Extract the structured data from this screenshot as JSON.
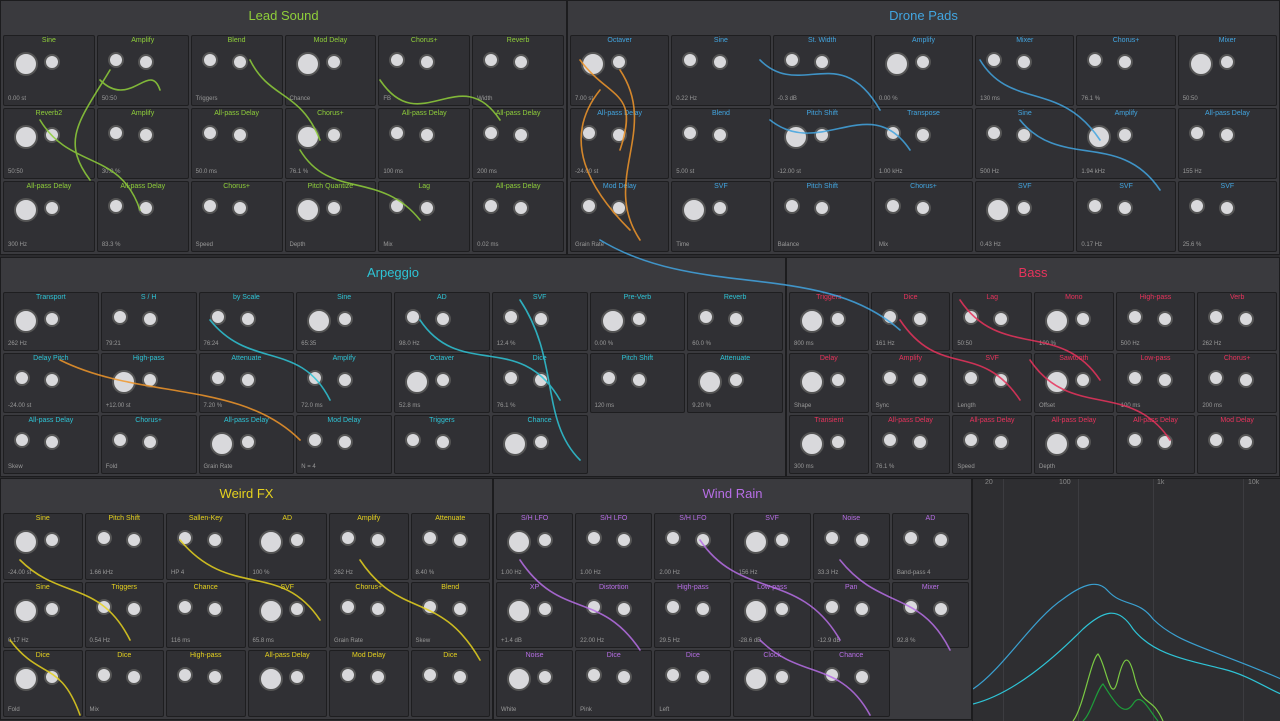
{
  "groups": {
    "lead": {
      "title": "Lead Sound",
      "color": "#8fcf3a",
      "modules": [
        "Sine",
        "Amplify",
        "Blend",
        "Mod Delay",
        "Chorus+",
        "Reverb",
        "Reverb2",
        "Amplify",
        "All-pass Delay",
        "Chorus+",
        "All-pass Delay",
        "All-pass Delay",
        "All-pass Delay",
        "All-pass Delay",
        "Chorus+",
        "Pitch Quantize",
        "Lag",
        "All-pass Delay"
      ],
      "params": [
        "0.00 st",
        "50:50",
        "Triggers",
        "Chance",
        "FB",
        "Width",
        "50:50",
        "30.0 %",
        "50.0 ms",
        "76.1 %",
        "100 ms",
        "200 ms",
        "300 Hz",
        "83.3 %",
        "Speed",
        "Depth",
        "Mix",
        "0.02 ms"
      ]
    },
    "drone": {
      "title": "Drone Pads",
      "color": "#42a5e0",
      "modules": [
        "Octaver",
        "Sine",
        "St. Width",
        "Amplify",
        "Mixer",
        "Chorus+",
        "Mixer",
        "All-pass Delay",
        "Blend",
        "Pitch Shift",
        "Transpose",
        "Sine",
        "Amplify",
        "All-pass Delay",
        "Mod Delay",
        "SVF",
        "Pitch Shift",
        "Chorus+",
        "SVF",
        "SVF",
        "SVF"
      ],
      "params": [
        "7.00 st",
        "0.22 Hz",
        "-0.3 dB",
        "0.00 %",
        "130 ms",
        "76.1 %",
        "50:50",
        "-24.00 st",
        "5.00 st",
        "-12.00 st",
        "1.00 kHz",
        "500 Hz",
        "1.94 kHz",
        "155 Hz",
        "Grain Rate",
        "Time",
        "Balance",
        "Mix",
        "0.43 Hz",
        "0.17 Hz",
        "25.6 %"
      ]
    },
    "arp": {
      "title": "Arpeggio",
      "color": "#2ec4d6",
      "modules": [
        "Transport",
        "S / H",
        "by Scale",
        "Sine",
        "AD",
        "SVF",
        "Pre-Verb",
        "Reverb",
        "Delay Pitch",
        "High-pass",
        "Attenuate",
        "Amplify",
        "Octaver",
        "Dice",
        "Pitch Shift",
        "Attenuate",
        "All-pass Delay",
        "Chorus+",
        "All-pass Delay",
        "Mod Delay",
        "Triggers",
        "Chance"
      ],
      "params": [
        "262 Hz",
        "79:21",
        "76:24",
        "65:35",
        "98.0 Hz",
        "12.4 %",
        "0.00 %",
        "60.0 %",
        "-24.00 st",
        "+12.00 st",
        "7.20 %",
        "72.0 ms",
        "52.8 ms",
        "76.1 %",
        "120 ms",
        "9.20 %",
        "Skew",
        "Fold",
        "Grain Rate",
        "N = 4"
      ]
    },
    "bass": {
      "title": "Bass",
      "color": "#e8335c",
      "modules": [
        "Triggers",
        "Dice",
        "Lag",
        "Mono",
        "High-pass",
        "Verb",
        "Delay",
        "Amplify",
        "SVF",
        "Sawtooth",
        "Low-pass",
        "Chorus+",
        "Transient",
        "All-pass Delay",
        "All-pass Delay",
        "All-pass Delay",
        "All-pass Delay",
        "Mod Delay"
      ],
      "params": [
        "800 ms",
        "161 Hz",
        "50:50",
        "100 %",
        "500 Hz",
        "262 Hz",
        "Shape",
        "Sync",
        "Length",
        "Offset",
        "100 ms",
        "200 ms",
        "300 ms",
        "76.1 %",
        "Speed",
        "Depth"
      ]
    },
    "weird": {
      "title": "Weird FX",
      "color": "#e6d21e",
      "modules": [
        "Sine",
        "Pitch Shift",
        "Sallen-Key",
        "AD",
        "Amplify",
        "Attenuate",
        "Sine",
        "Triggers",
        "Chance",
        "SVF",
        "Chorus+",
        "Blend",
        "Dice",
        "Dice",
        "High-pass",
        "All-pass Delay",
        "Mod Delay",
        "Dice"
      ],
      "params": [
        "-24.00 st",
        "1.66 kHz",
        "HP 4",
        "100 %",
        "262 Hz",
        "8.40 %",
        "0.17 Hz",
        "0.54 Hz",
        "116 ms",
        "65.8 ms",
        "Grain Rate",
        "Skew",
        "Fold",
        "Mix"
      ]
    },
    "rain": {
      "title": "Wind Rain",
      "color": "#b76ee6",
      "modules": [
        "S/H LFO",
        "S/H LFO",
        "S/H LFO",
        "SVF",
        "Noise",
        "AD",
        "XP",
        "Distortion",
        "High-pass",
        "Low-pass",
        "Pan",
        "Mixer",
        "Noise",
        "Dice",
        "Dice",
        "Clock",
        "Chance"
      ],
      "params": [
        "1.00 Hz",
        "1.00 Hz",
        "2.00 Hz",
        "156 Hz",
        "33.3 Hz",
        "Band-pass 4",
        "+1.4 dB",
        "22.00 Hz",
        "29.5 Hz",
        "-28.6 dB",
        "-12.9 dB",
        "92.8 %",
        "White",
        "Pink",
        "Left"
      ]
    }
  },
  "spectrum": {
    "freq_labels": [
      "20",
      "100",
      "1k",
      "10k"
    ],
    "colors": [
      "#3aa0d0",
      "#2ec4d6",
      "#7ac943",
      "#1e9c3a"
    ]
  },
  "wire_colors": [
    "#8fcf3a",
    "#f0962a",
    "#42a5e0",
    "#2ec4d6",
    "#e8335c",
    "#e6d21e",
    "#b76ee6"
  ]
}
